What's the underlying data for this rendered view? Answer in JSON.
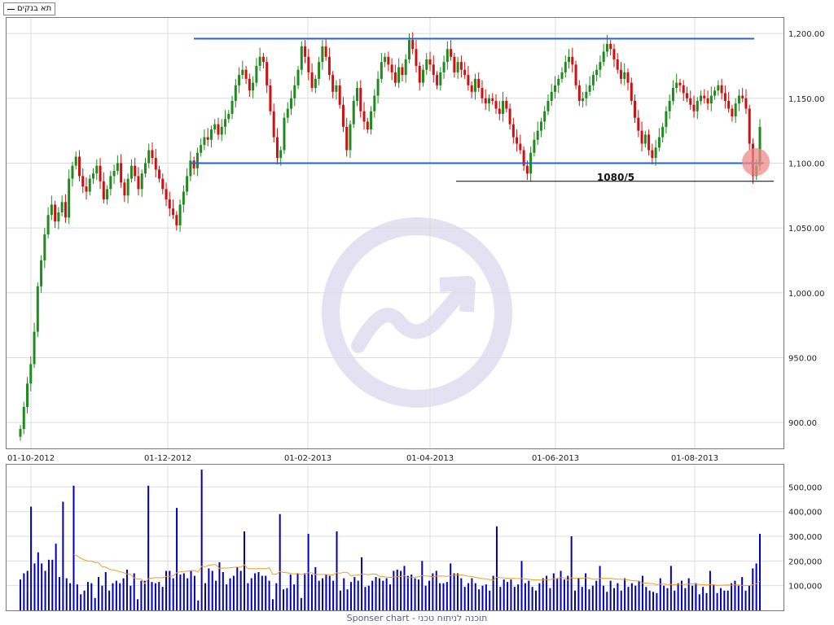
{
  "legend": {
    "label": "תא בנקים"
  },
  "footer": {
    "text": "Sponser chart - תוכנה לניתוח טכני"
  },
  "colors": {
    "up": "#1f8b1f",
    "down": "#d01010",
    "volume": "#0000b4",
    "volume_ma": "#f0a020",
    "level": "#2266cc",
    "support": "#000000",
    "highlight": "#f08a8a",
    "watermark": "#e4e2f2"
  },
  "annotation": {
    "label": "1080/5"
  },
  "chart_data": [
    {
      "type": "candlestick",
      "title": "",
      "x_ticks": [
        "01-10-2012",
        "01-12-2012",
        "01-02-2013",
        "01-04-2013",
        "01-06-2013",
        "01-08-2013"
      ],
      "y_ticks": [
        "900.00",
        "950.00",
        "1,000.00",
        "1,050.00",
        "1,100.00",
        "1,150.00",
        "1,200.00"
      ],
      "ylim": [
        880,
        1212
      ],
      "grid": true,
      "close": [
        895,
        912,
        930,
        945,
        970,
        1005,
        1025,
        1045,
        1060,
        1068,
        1055,
        1062,
        1070,
        1058,
        1088,
        1098,
        1105,
        1090,
        1082,
        1078,
        1088,
        1092,
        1098,
        1086,
        1072,
        1080,
        1090,
        1094,
        1100,
        1085,
        1075,
        1088,
        1098,
        1090,
        1080,
        1092,
        1100,
        1110,
        1104,
        1095,
        1088,
        1080,
        1072,
        1065,
        1060,
        1052,
        1068,
        1078,
        1090,
        1102,
        1096,
        1108,
        1114,
        1120,
        1118,
        1126,
        1130,
        1122,
        1128,
        1134,
        1138,
        1148,
        1160,
        1168,
        1172,
        1165,
        1156,
        1162,
        1175,
        1182,
        1178,
        1160,
        1140,
        1120,
        1104,
        1110,
        1135,
        1142,
        1150,
        1160,
        1172,
        1190,
        1182,
        1170,
        1158,
        1165,
        1178,
        1190,
        1182,
        1168,
        1155,
        1160,
        1145,
        1128,
        1110,
        1130,
        1148,
        1158,
        1140,
        1132,
        1126,
        1140,
        1152,
        1165,
        1178,
        1182,
        1176,
        1170,
        1162,
        1174,
        1168,
        1180,
        1195,
        1188,
        1175,
        1162,
        1172,
        1180,
        1176,
        1168,
        1160,
        1170,
        1178,
        1188,
        1182,
        1170,
        1178,
        1172,
        1168,
        1160,
        1155,
        1165,
        1158,
        1150,
        1146,
        1150,
        1148,
        1142,
        1138,
        1148,
        1142,
        1130,
        1120,
        1115,
        1110,
        1098,
        1092,
        1108,
        1118,
        1125,
        1132,
        1140,
        1148,
        1155,
        1160,
        1165,
        1170,
        1178,
        1182,
        1176,
        1160,
        1148,
        1150,
        1155,
        1160,
        1168,
        1172,
        1178,
        1186,
        1192,
        1188,
        1180,
        1172,
        1165,
        1170,
        1162,
        1148,
        1135,
        1125,
        1115,
        1122,
        1110,
        1104,
        1112,
        1120,
        1128,
        1140,
        1148,
        1158,
        1162,
        1160,
        1154,
        1150,
        1145,
        1140,
        1148,
        1152,
        1150,
        1146,
        1152,
        1156,
        1160,
        1154,
        1148,
        1142,
        1136,
        1146,
        1152,
        1150,
        1142,
        1115,
        1090,
        1098,
        1128
      ],
      "volume_ticks": [
        "100,000",
        "200,000",
        "300,000",
        "400,000",
        "500,000"
      ],
      "volume": [
        125,
        150,
        160,
        420,
        190,
        235,
        190,
        160,
        205,
        205,
        270,
        135,
        440,
        130,
        110,
        505,
        105,
        65,
        80,
        115,
        110,
        50,
        135,
        100,
        155,
        80,
        110,
        120,
        110,
        130,
        165,
        100,
        150,
        45,
        120,
        120,
        505,
        115,
        110,
        115,
        95,
        160,
        160,
        130,
        415,
        145,
        150,
        130,
        160,
        140,
        40,
        570,
        110,
        170,
        160,
        120,
        195,
        155,
        105,
        130,
        140,
        175,
        160,
        320,
        110,
        130,
        150,
        155,
        140,
        140,
        120,
        45,
        110,
        390,
        85,
        90,
        145,
        105,
        150,
        50,
        150,
        310,
        145,
        175,
        120,
        130,
        145,
        140,
        120,
        320,
        80,
        130,
        85,
        115,
        135,
        120,
        215,
        95,
        100,
        120,
        135,
        130,
        120,
        130,
        105,
        160,
        165,
        160,
        180,
        140,
        145,
        130,
        125,
        200,
        100,
        120,
        150,
        160,
        110,
        110,
        115,
        190,
        150,
        150,
        130,
        95,
        110,
        130,
        110,
        85,
        100,
        105,
        80,
        140,
        340,
        95,
        125,
        115,
        125,
        95,
        105,
        200,
        110,
        120,
        95,
        80,
        110,
        130,
        140,
        90,
        150,
        130,
        160,
        125,
        140,
        300,
        80,
        130,
        95,
        150,
        85,
        100,
        120,
        180,
        100,
        75,
        120,
        90,
        110,
        80,
        130,
        95,
        110,
        100,
        120,
        140,
        95,
        80,
        75,
        70,
        130,
        100,
        90,
        180,
        80,
        110,
        120,
        90,
        130,
        100,
        110,
        65,
        95,
        70,
        160,
        105,
        70,
        90,
        80,
        80,
        110,
        120,
        100,
        135,
        80,
        100,
        170,
        190,
        310
      ],
      "volume_ma_start": 200,
      "volume_ma_end": 90,
      "levels": [
        {
          "name": "resistance",
          "value": 1196
        },
        {
          "name": "support",
          "value": 1100
        },
        {
          "name": "low-support",
          "value": 1086,
          "label": "1080/5"
        }
      ]
    }
  ]
}
